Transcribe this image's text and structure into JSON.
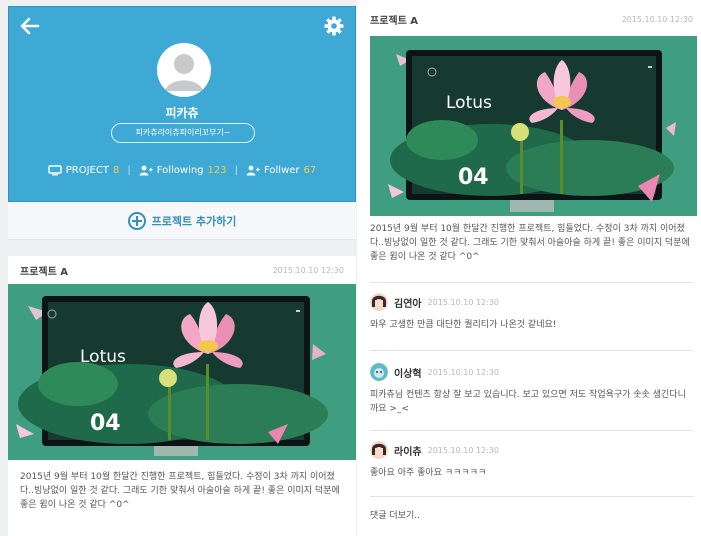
{
  "profile": {
    "name": "피카츄",
    "url_label": "피카츄라이츄파이리꼬부기~",
    "stats": [
      {
        "icon": "monitor-icon",
        "label": "PROJECT",
        "value": "8"
      },
      {
        "icon": "user-plus-icon",
        "label": "Following",
        "value": "123"
      },
      {
        "icon": "user-plus-icon",
        "label": "Follwer",
        "value": "67"
      }
    ],
    "accent_color": "#3ea9d4",
    "count_color": "#f2c94c"
  },
  "add_project": {
    "label": "프로젝트 추가하기"
  },
  "feed_card": {
    "title": "프로젝트 A",
    "date": "2015.10.10 12:30",
    "image": {
      "word": "Lotus",
      "number": "04"
    },
    "body": "2015년 9월 부터 10월 한달간 진행한 프로젝트, 힘들었다. 수정이 3차 까지 이어졌다..빙냥없이 일한 것 같다. 그래도 기한 맞춰서 아슬아슬 하게 끝! 좋은 이미지 덕분에 좋은 윔이 나온 것 같다 ^0^"
  },
  "detail": {
    "title": "프로젝트 A",
    "date": "2015.10.10 12:30",
    "image": {
      "word": "Lotus",
      "number": "04"
    },
    "body": "2015년 9월 부터 10월 한달간 진행한 프로젝트, 힘들었다. 수정이 3차 까지 이어졌다..빙냥없이 일한 것 같다. 그래도 기한 맞춰서 아슬아슬 하게 끝! 좋은 이미지 덕분에 좋은 윔이 나온 것 같다 ^0^",
    "comments": [
      {
        "name": "김연아",
        "date": "2015.10.10 12:30",
        "text": "와우 고생한 만큼 대단한 퀄리티가 나온것 같네요!"
      },
      {
        "name": "이상혁",
        "date": "2015.10.10 12:30",
        "text": "피카츄님 컨텐츠 항상 잘 보고 있습니다. 보고 있으면 저도 작업욕구가 솟솟 생긴다니까요 >_<"
      },
      {
        "name": "라이츄",
        "date": "2015.10.10 12:30",
        "text": "좋아요 아주 좋아요 ㅋㅋㅋㅋㅋ"
      }
    ],
    "more_label": "댓글 더보기.."
  }
}
